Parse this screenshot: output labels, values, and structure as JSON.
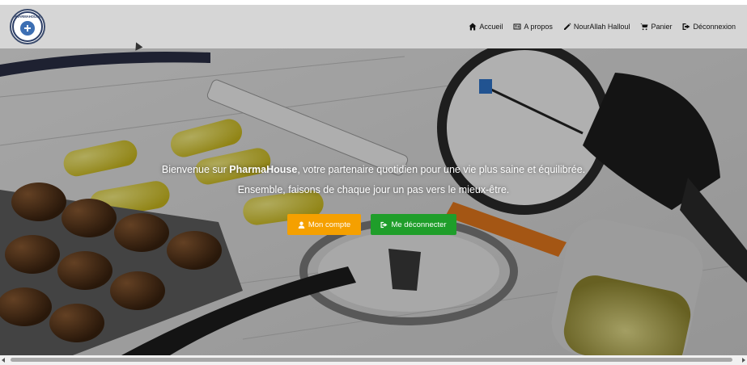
{
  "navbar": {
    "logo_text": "PHARMAHOUSE",
    "items": [
      {
        "label": "Accueil",
        "icon": "home-icon"
      },
      {
        "label": "A propos",
        "icon": "id-card-icon"
      },
      {
        "label": "NourAllah Halloul",
        "icon": "pencil-icon"
      },
      {
        "label": "Panier",
        "icon": "cart-icon"
      },
      {
        "label": "Déconnexion",
        "icon": "sign-out-icon"
      }
    ]
  },
  "hero": {
    "line1_prefix": "Bienvenue sur ",
    "line1_brand": "PharmaHouse",
    "line1_suffix": ", votre partenaire quotidien pour une vie plus saine et équilibrée.",
    "line2": "Ensemble, faisons de chaque jour un pas vers le mieux-être.",
    "buttons": {
      "account": {
        "label": "Mon compte",
        "icon": "user-icon",
        "color": "#f5a000"
      },
      "logout": {
        "label": "Me déconnecter",
        "icon": "sign-out-icon",
        "color": "#1f9e2a"
      }
    }
  },
  "colors": {
    "navbar_bg": "#d6d6d6",
    "accent_orange": "#f5a000",
    "accent_green": "#1f9e2a"
  }
}
